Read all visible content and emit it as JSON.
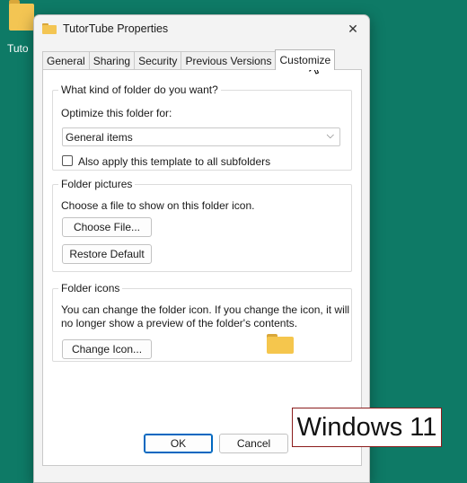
{
  "desktop": {
    "folder_label": "Tuto"
  },
  "dialog": {
    "title": "TutorTube Properties",
    "tabs": [
      "General",
      "Sharing",
      "Security",
      "Previous Versions",
      "Customize"
    ],
    "active_tab": "Customize",
    "folder_type": {
      "legend": "What kind of folder do you want?",
      "optimize_label": "Optimize this folder for:",
      "selected": "General items",
      "apply_subfolders_label": "Also apply this template to all subfolders",
      "apply_subfolders_checked": false
    },
    "folder_pictures": {
      "legend": "Folder pictures",
      "description": "Choose a file to show on this folder icon.",
      "choose_file_label": "Choose File...",
      "restore_default_label": "Restore Default"
    },
    "folder_icons": {
      "legend": "Folder icons",
      "description_line1": "You can change the folder icon. If you change the icon, it will",
      "description_line2": "no longer show a preview of the folder's contents.",
      "change_icon_label": "Change Icon..."
    },
    "footer": {
      "ok_label": "OK",
      "cancel_label": "Cancel"
    }
  },
  "overlay_badge": "Windows 11",
  "colors": {
    "desktop_bg": "#0e7a66",
    "folder_yellow": "#f5c64d",
    "ok_border": "#0067c0",
    "badge_border": "#8b1c1c"
  }
}
